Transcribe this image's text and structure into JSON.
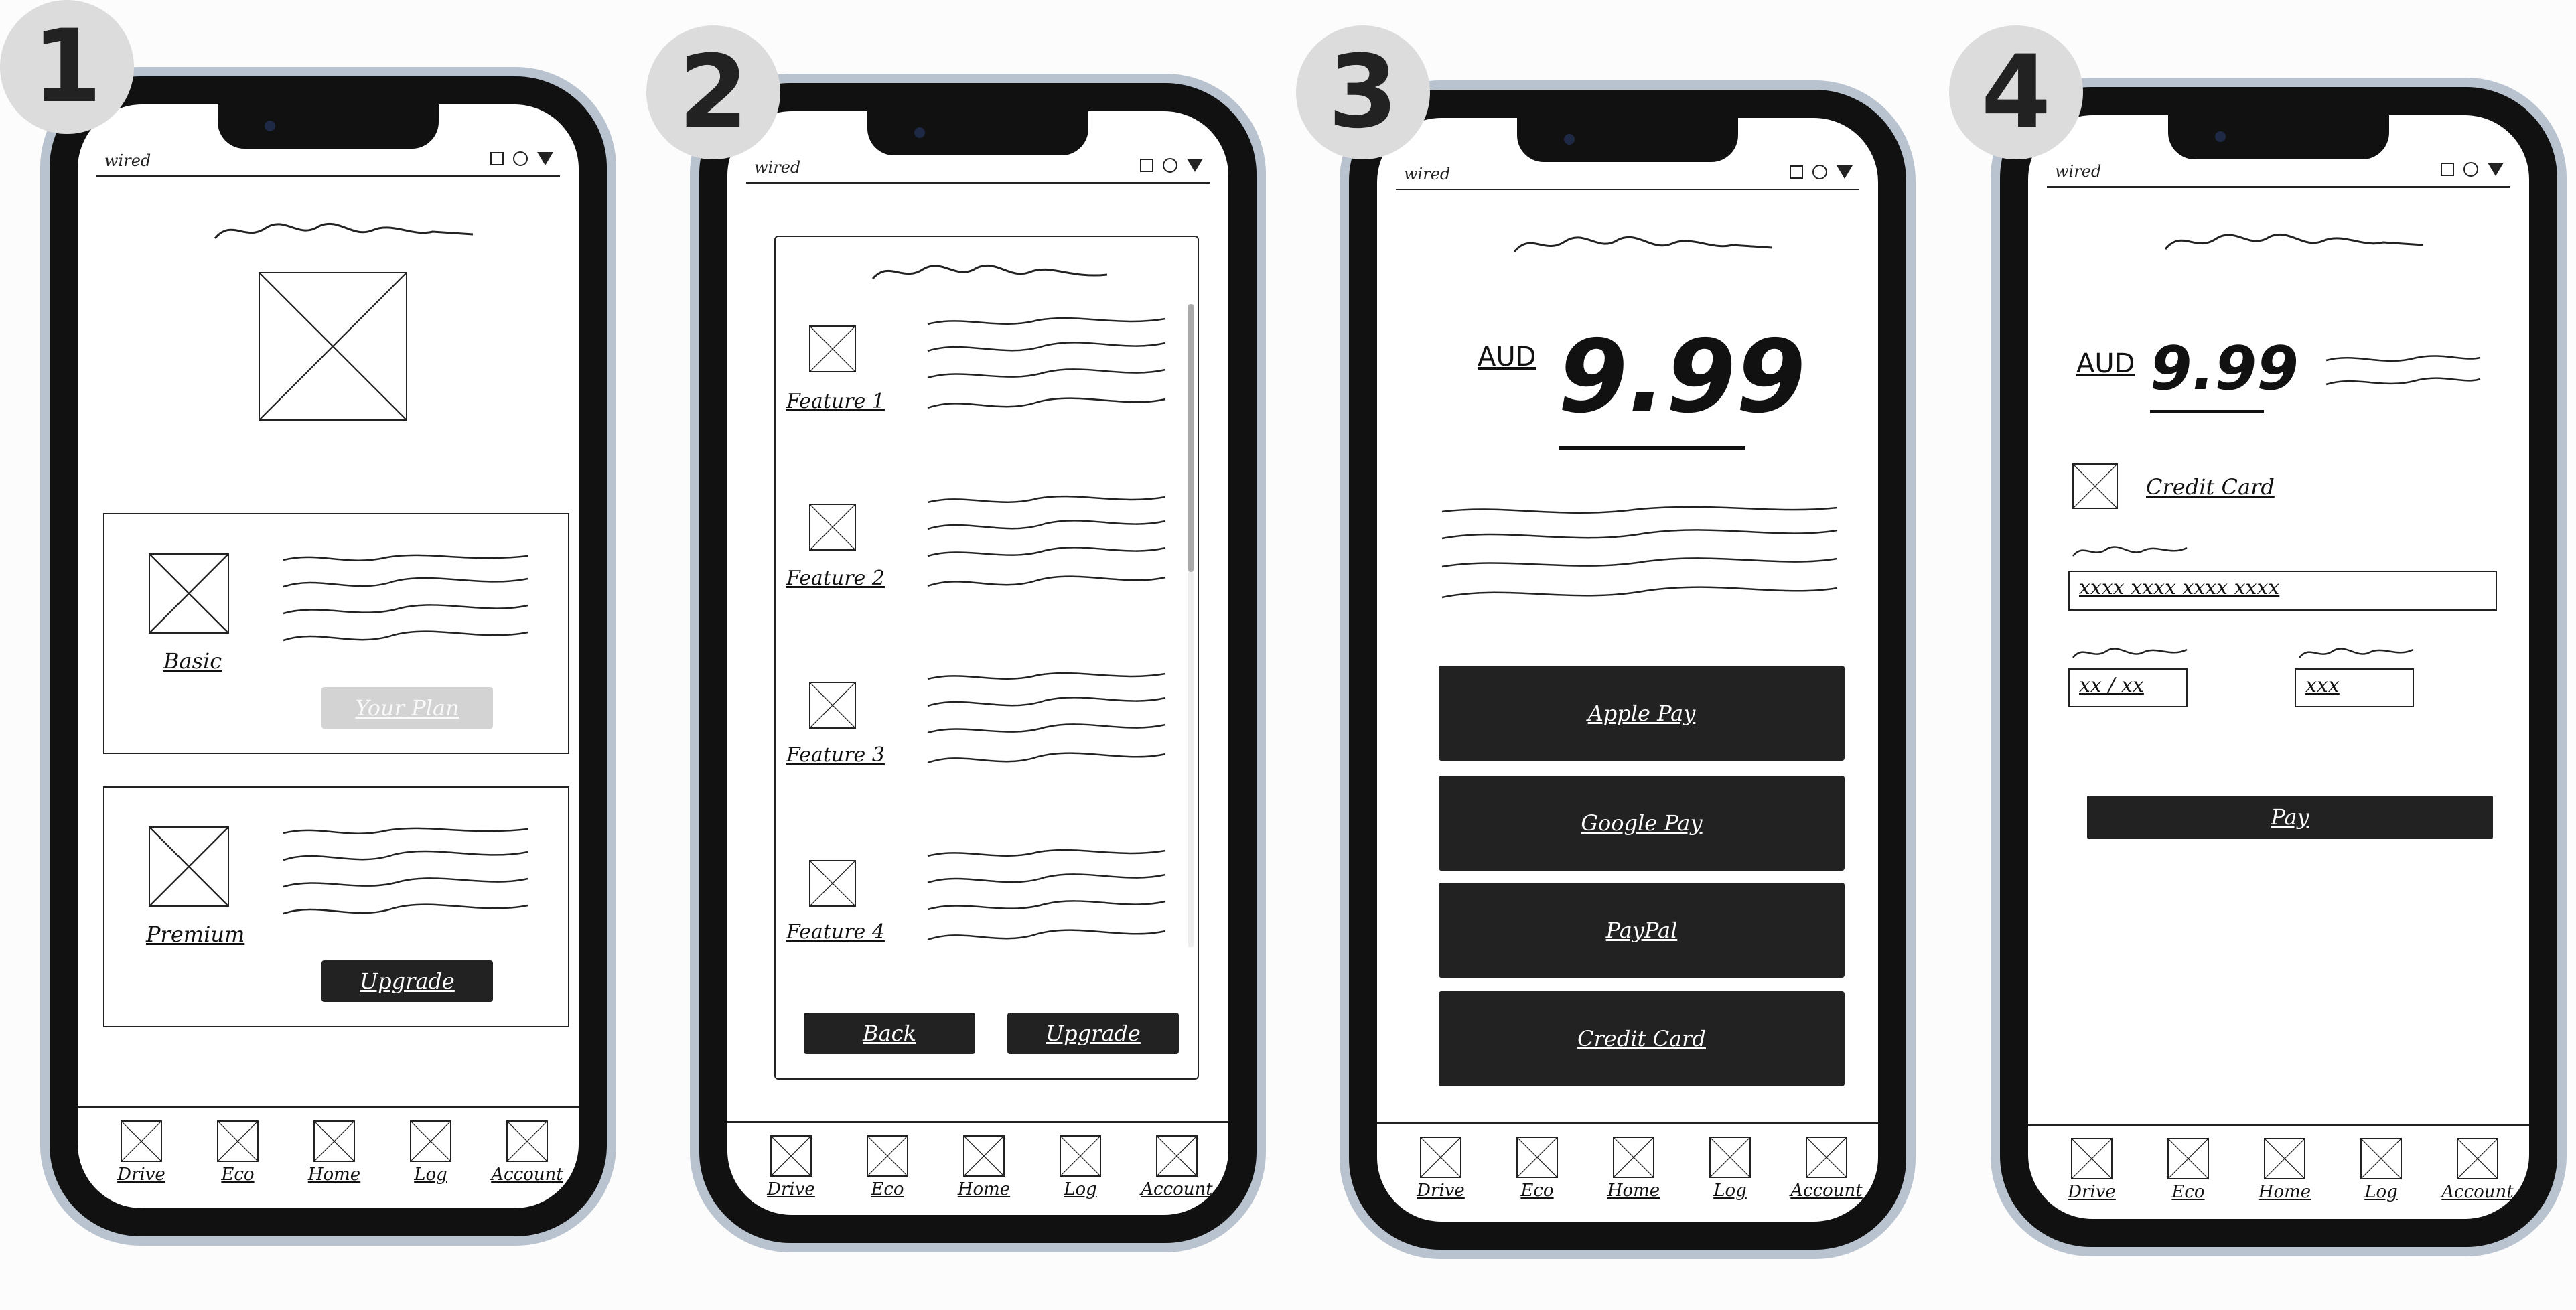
{
  "steps": [
    "1",
    "2",
    "3",
    "4"
  ],
  "titlebar": {
    "logo": "wired"
  },
  "tabs": [
    "Drive",
    "Eco",
    "Home",
    "Log",
    "Account"
  ],
  "screen1": {
    "plans": [
      {
        "name": "Basic",
        "button": "Your Plan"
      },
      {
        "name": "Premium",
        "button": "Upgrade"
      }
    ]
  },
  "screen2": {
    "features": [
      "Feature 1",
      "Feature 2",
      "Feature 3",
      "Feature 4"
    ],
    "back_button": "Back",
    "upgrade_button": "Upgrade"
  },
  "screen3": {
    "currency": "AUD",
    "price": "9.99",
    "payment_options": [
      "Apple Pay",
      "Google Pay",
      "PayPal",
      "Credit Card"
    ]
  },
  "screen4": {
    "currency": "AUD",
    "price": "9.99",
    "credit_card_label": "Credit Card",
    "card_number_value": "xxxx xxxx xxxx xxxx",
    "expiry_value": "xx / xx",
    "cvv_value": "xxx",
    "pay_button": "Pay"
  }
}
